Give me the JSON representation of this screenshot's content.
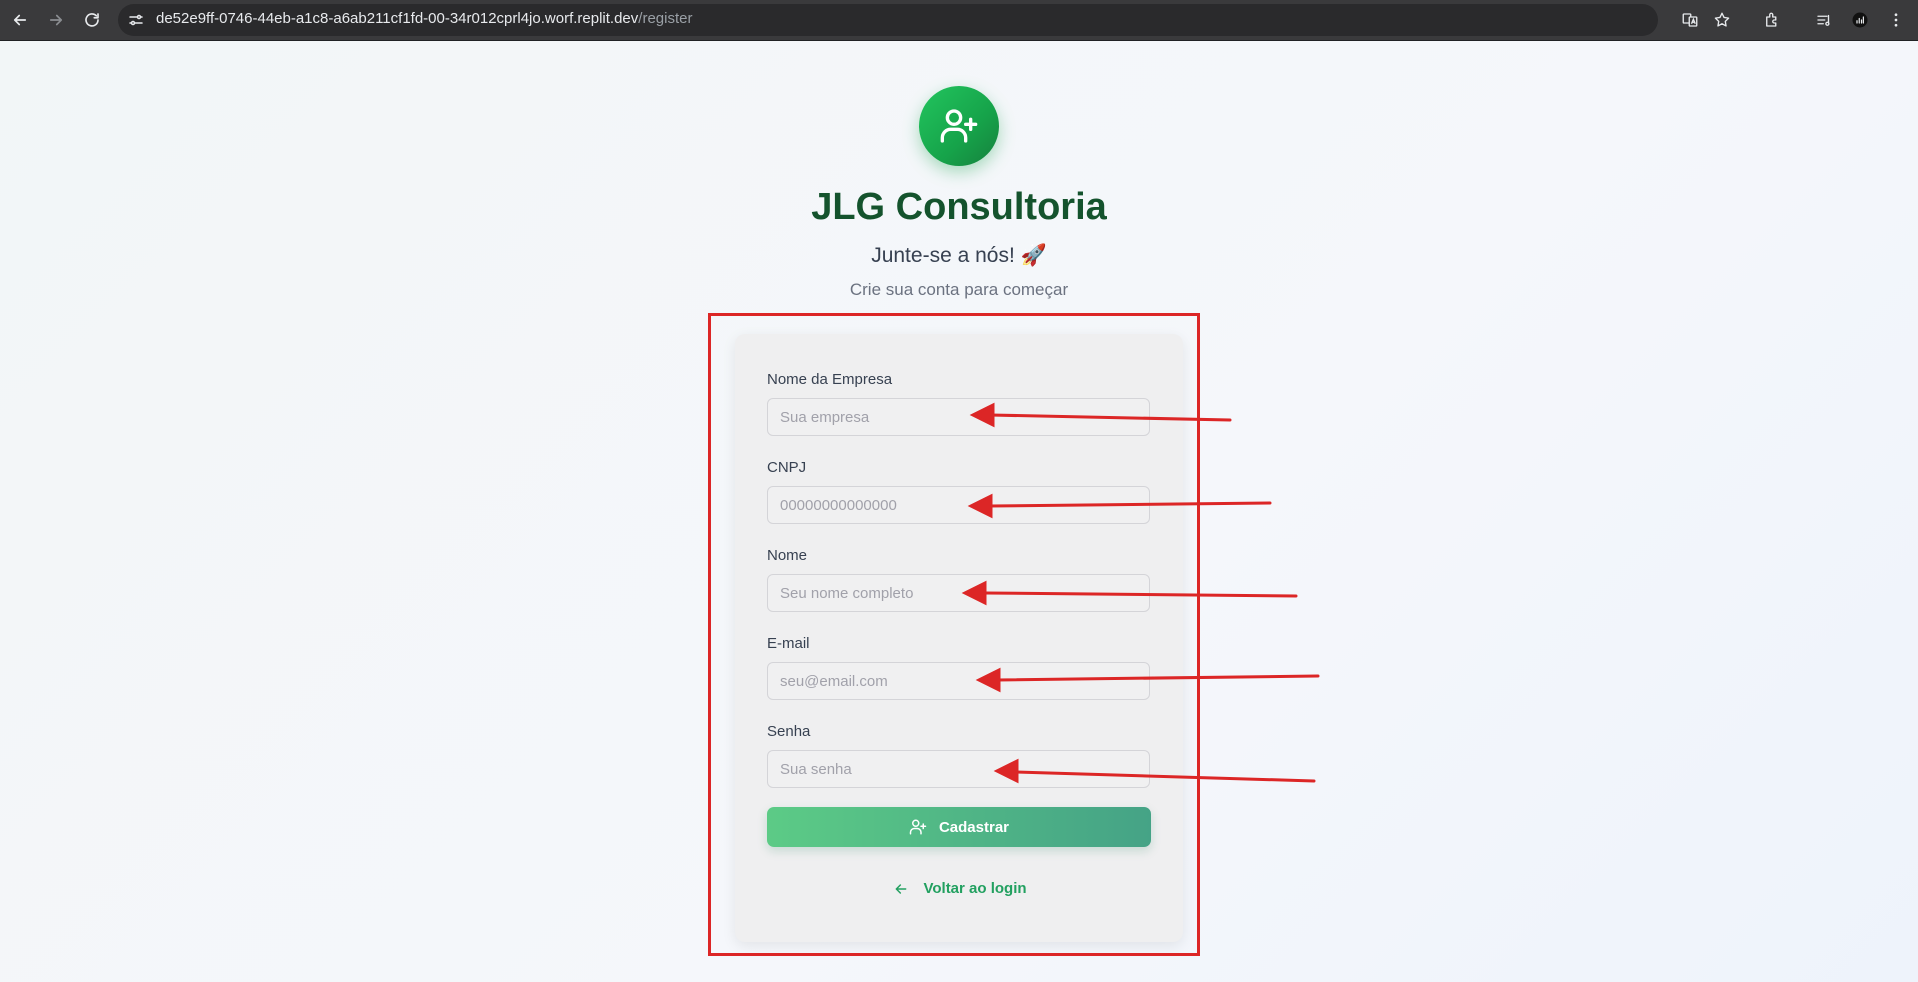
{
  "browser": {
    "url_host": "de52e9ff-0746-44eb-a1c8-a6ab211cf1fd-00-34r012cprl4jo.worf.replit.dev",
    "url_path": "/register",
    "icons": [
      "back-icon",
      "forward-icon",
      "reload-icon",
      "site-info-icon",
      "translate-icon",
      "star-icon",
      "extensions-icon",
      "media-icon",
      "profile-icon",
      "menu-icon"
    ]
  },
  "header": {
    "logo_icon": "user-plus-icon",
    "title": "JLG Consultoria",
    "welcome": "Junte-se a nós! 🚀",
    "subtitle": "Crie sua conta para começar"
  },
  "form": {
    "fields": [
      {
        "label": "Nome da Empresa",
        "placeholder": "Sua empresa",
        "value": ""
      },
      {
        "label": "CNPJ",
        "placeholder": "00000000000000",
        "value": ""
      },
      {
        "label": "Nome",
        "placeholder": "Seu nome completo",
        "value": ""
      },
      {
        "label": "E-mail",
        "placeholder": "seu@email.com",
        "value": ""
      },
      {
        "label": "Senha",
        "placeholder": "Sua senha",
        "value": ""
      }
    ],
    "submit_label": "Cadastrar",
    "back_label": "Voltar ao login"
  },
  "colors": {
    "brand_green": "#16a34a",
    "title_green": "#14532d",
    "annotation_red": "#dc2626"
  }
}
